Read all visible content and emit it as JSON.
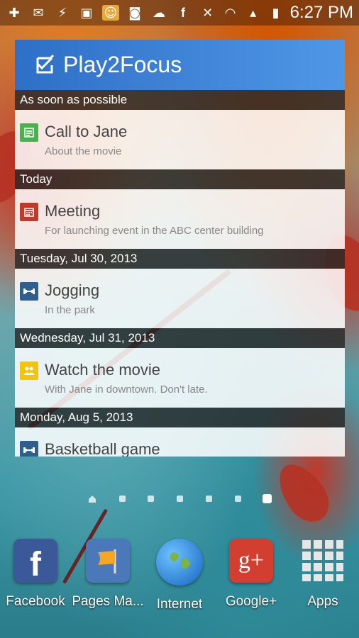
{
  "status_bar": {
    "time": "6:27 PM",
    "left_icons": [
      "add-icon",
      "mail-icon",
      "usb-icon",
      "image-icon",
      "game-icon",
      "instagram-icon",
      "cloud-icon",
      "facebook-icon"
    ],
    "right_icons": [
      "mute-icon",
      "wifi-icon",
      "signal-icon",
      "battery-charging-icon"
    ]
  },
  "widget": {
    "app_title": "Play2Focus",
    "sections": [
      {
        "header": "As soon as possible",
        "task": {
          "title": "Call to Jane",
          "subtitle": "About the movie",
          "icon": "note-icon",
          "color": "#4caf50"
        }
      },
      {
        "header": "Today",
        "task": {
          "title": "Meeting",
          "subtitle": "For launching event in the ABC center building",
          "icon": "calendar-icon",
          "color": "#c0392b"
        }
      },
      {
        "header": "Tuesday, Jul 30, 2013",
        "task": {
          "title": "Jogging",
          "subtitle": "In the park",
          "icon": "dumbbell-icon",
          "color": "#2e5f8f"
        }
      },
      {
        "header": "Wednesday, Jul 31, 2013",
        "task": {
          "title": "Watch the movie",
          "subtitle": "With Jane in downtown. Don't late.",
          "icon": "people-icon",
          "color": "#f1c40f"
        }
      },
      {
        "header": "Monday, Aug 5, 2013",
        "task": {
          "title": "Basketball game",
          "subtitle": "",
          "icon": "dumbbell-icon",
          "color": "#2e5f8f"
        }
      }
    ]
  },
  "page_indicator": {
    "pages": 7,
    "active_index": 6
  },
  "dock": {
    "apps": [
      {
        "label": "Facebook",
        "icon": "facebook-app-icon",
        "color": "#3b5998"
      },
      {
        "label": "Pages Ma...",
        "icon": "pages-manager-icon",
        "color": "#4a78b8"
      },
      {
        "label": "Internet",
        "icon": "globe-icon",
        "color": "#1e88e5"
      },
      {
        "label": "Google+",
        "icon": "google-plus-icon",
        "color": "#d23f31"
      },
      {
        "label": "Apps",
        "icon": "apps-grid-icon",
        "color": "#dddddd"
      }
    ]
  }
}
